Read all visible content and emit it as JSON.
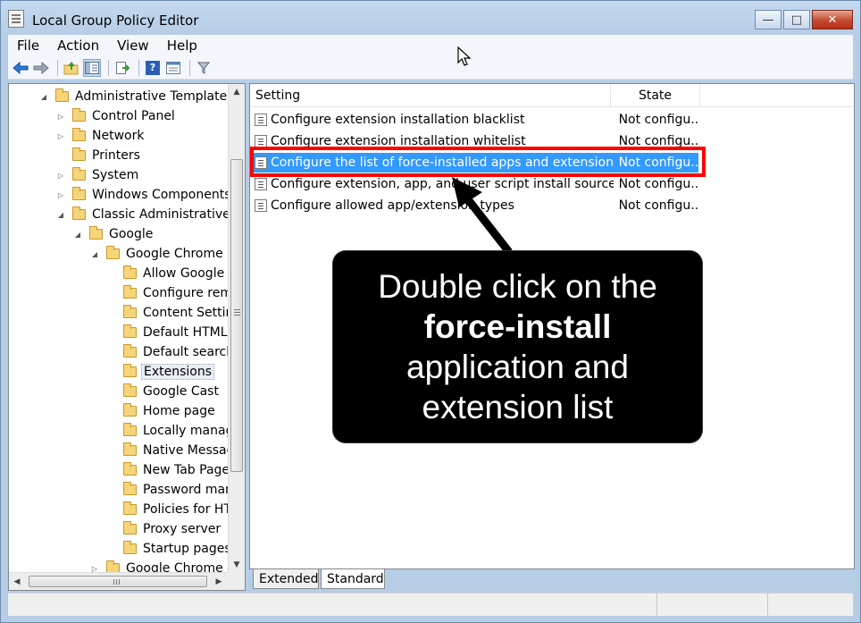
{
  "window": {
    "title": "Local Group Policy Editor",
    "buttons": {
      "minimize": "—",
      "maximize": "□",
      "close": "✕"
    }
  },
  "menu": [
    "File",
    "Action",
    "View",
    "Help"
  ],
  "toolbar": {
    "icons": [
      "back-arrow-icon",
      "forward-arrow-icon",
      "up-folder-icon",
      "show-hide-tree-icon",
      "export-list-icon",
      "help-icon",
      "properties-icon",
      "filter-icon"
    ]
  },
  "tree": {
    "items": [
      {
        "label": "Administrative Templates",
        "depth": 1,
        "expander": "expanded"
      },
      {
        "label": "Control Panel",
        "depth": 2,
        "expander": "collapsed"
      },
      {
        "label": "Network",
        "depth": 2,
        "expander": "collapsed"
      },
      {
        "label": "Printers",
        "depth": 2,
        "expander": "none"
      },
      {
        "label": "System",
        "depth": 2,
        "expander": "collapsed"
      },
      {
        "label": "Windows Components",
        "depth": 2,
        "expander": "collapsed"
      },
      {
        "label": "Classic Administrative Te",
        "depth": 2,
        "expander": "expanded"
      },
      {
        "label": "Google",
        "depth": 3,
        "expander": "expanded"
      },
      {
        "label": "Google Chrome",
        "depth": 4,
        "expander": "expanded"
      },
      {
        "label": "Allow Google C",
        "depth": 5,
        "expander": "none"
      },
      {
        "label": "Configure remo",
        "depth": 5,
        "expander": "none"
      },
      {
        "label": "Content Setting",
        "depth": 5,
        "expander": "none"
      },
      {
        "label": "Default HTML r",
        "depth": 5,
        "expander": "none"
      },
      {
        "label": "Default search p",
        "depth": 5,
        "expander": "none"
      },
      {
        "label": "Extensions",
        "depth": 5,
        "expander": "none",
        "selected": true
      },
      {
        "label": "Google Cast",
        "depth": 5,
        "expander": "none"
      },
      {
        "label": "Home page",
        "depth": 5,
        "expander": "none"
      },
      {
        "label": "Locally manage",
        "depth": 5,
        "expander": "none"
      },
      {
        "label": "Native Messagi",
        "depth": 5,
        "expander": "none"
      },
      {
        "label": "New Tab Page",
        "depth": 5,
        "expander": "none"
      },
      {
        "label": "Password mana",
        "depth": 5,
        "expander": "none"
      },
      {
        "label": "Policies for HTT",
        "depth": 5,
        "expander": "none"
      },
      {
        "label": "Proxy server",
        "depth": 5,
        "expander": "none"
      },
      {
        "label": "Startup pages",
        "depth": 5,
        "expander": "none"
      },
      {
        "label": "Google Chrome - I",
        "depth": 4,
        "expander": "collapsed"
      }
    ],
    "expander_glyphs": {
      "expanded": "◢",
      "collapsed": "▷",
      "none": ""
    },
    "scroll_glyphs": {
      "up": "▲",
      "down": "▼",
      "left": "◀",
      "right": "▶"
    }
  },
  "list": {
    "columns": {
      "setting": "Setting",
      "state": "State"
    },
    "rows": [
      {
        "setting": "Configure extension installation blacklist",
        "state": "Not configu..."
      },
      {
        "setting": "Configure extension installation whitelist",
        "state": "Not configu..."
      },
      {
        "setting": "Configure the list of force-installed apps and extensions",
        "state": "Not configu...",
        "selected": true
      },
      {
        "setting": "Configure extension, app, and user script install sources",
        "state": "Not configu..."
      },
      {
        "setting": "Configure allowed app/extension types",
        "state": "Not configu..."
      }
    ]
  },
  "tabs": [
    "Extended",
    "Standard"
  ],
  "callout": {
    "line1": "Double click on the",
    "line2": "force-install",
    "line3": "application and",
    "line4": "extension list"
  },
  "colors": {
    "selection": "#3399ff",
    "highlight": "#ff0000",
    "callout_bg": "#000000"
  }
}
